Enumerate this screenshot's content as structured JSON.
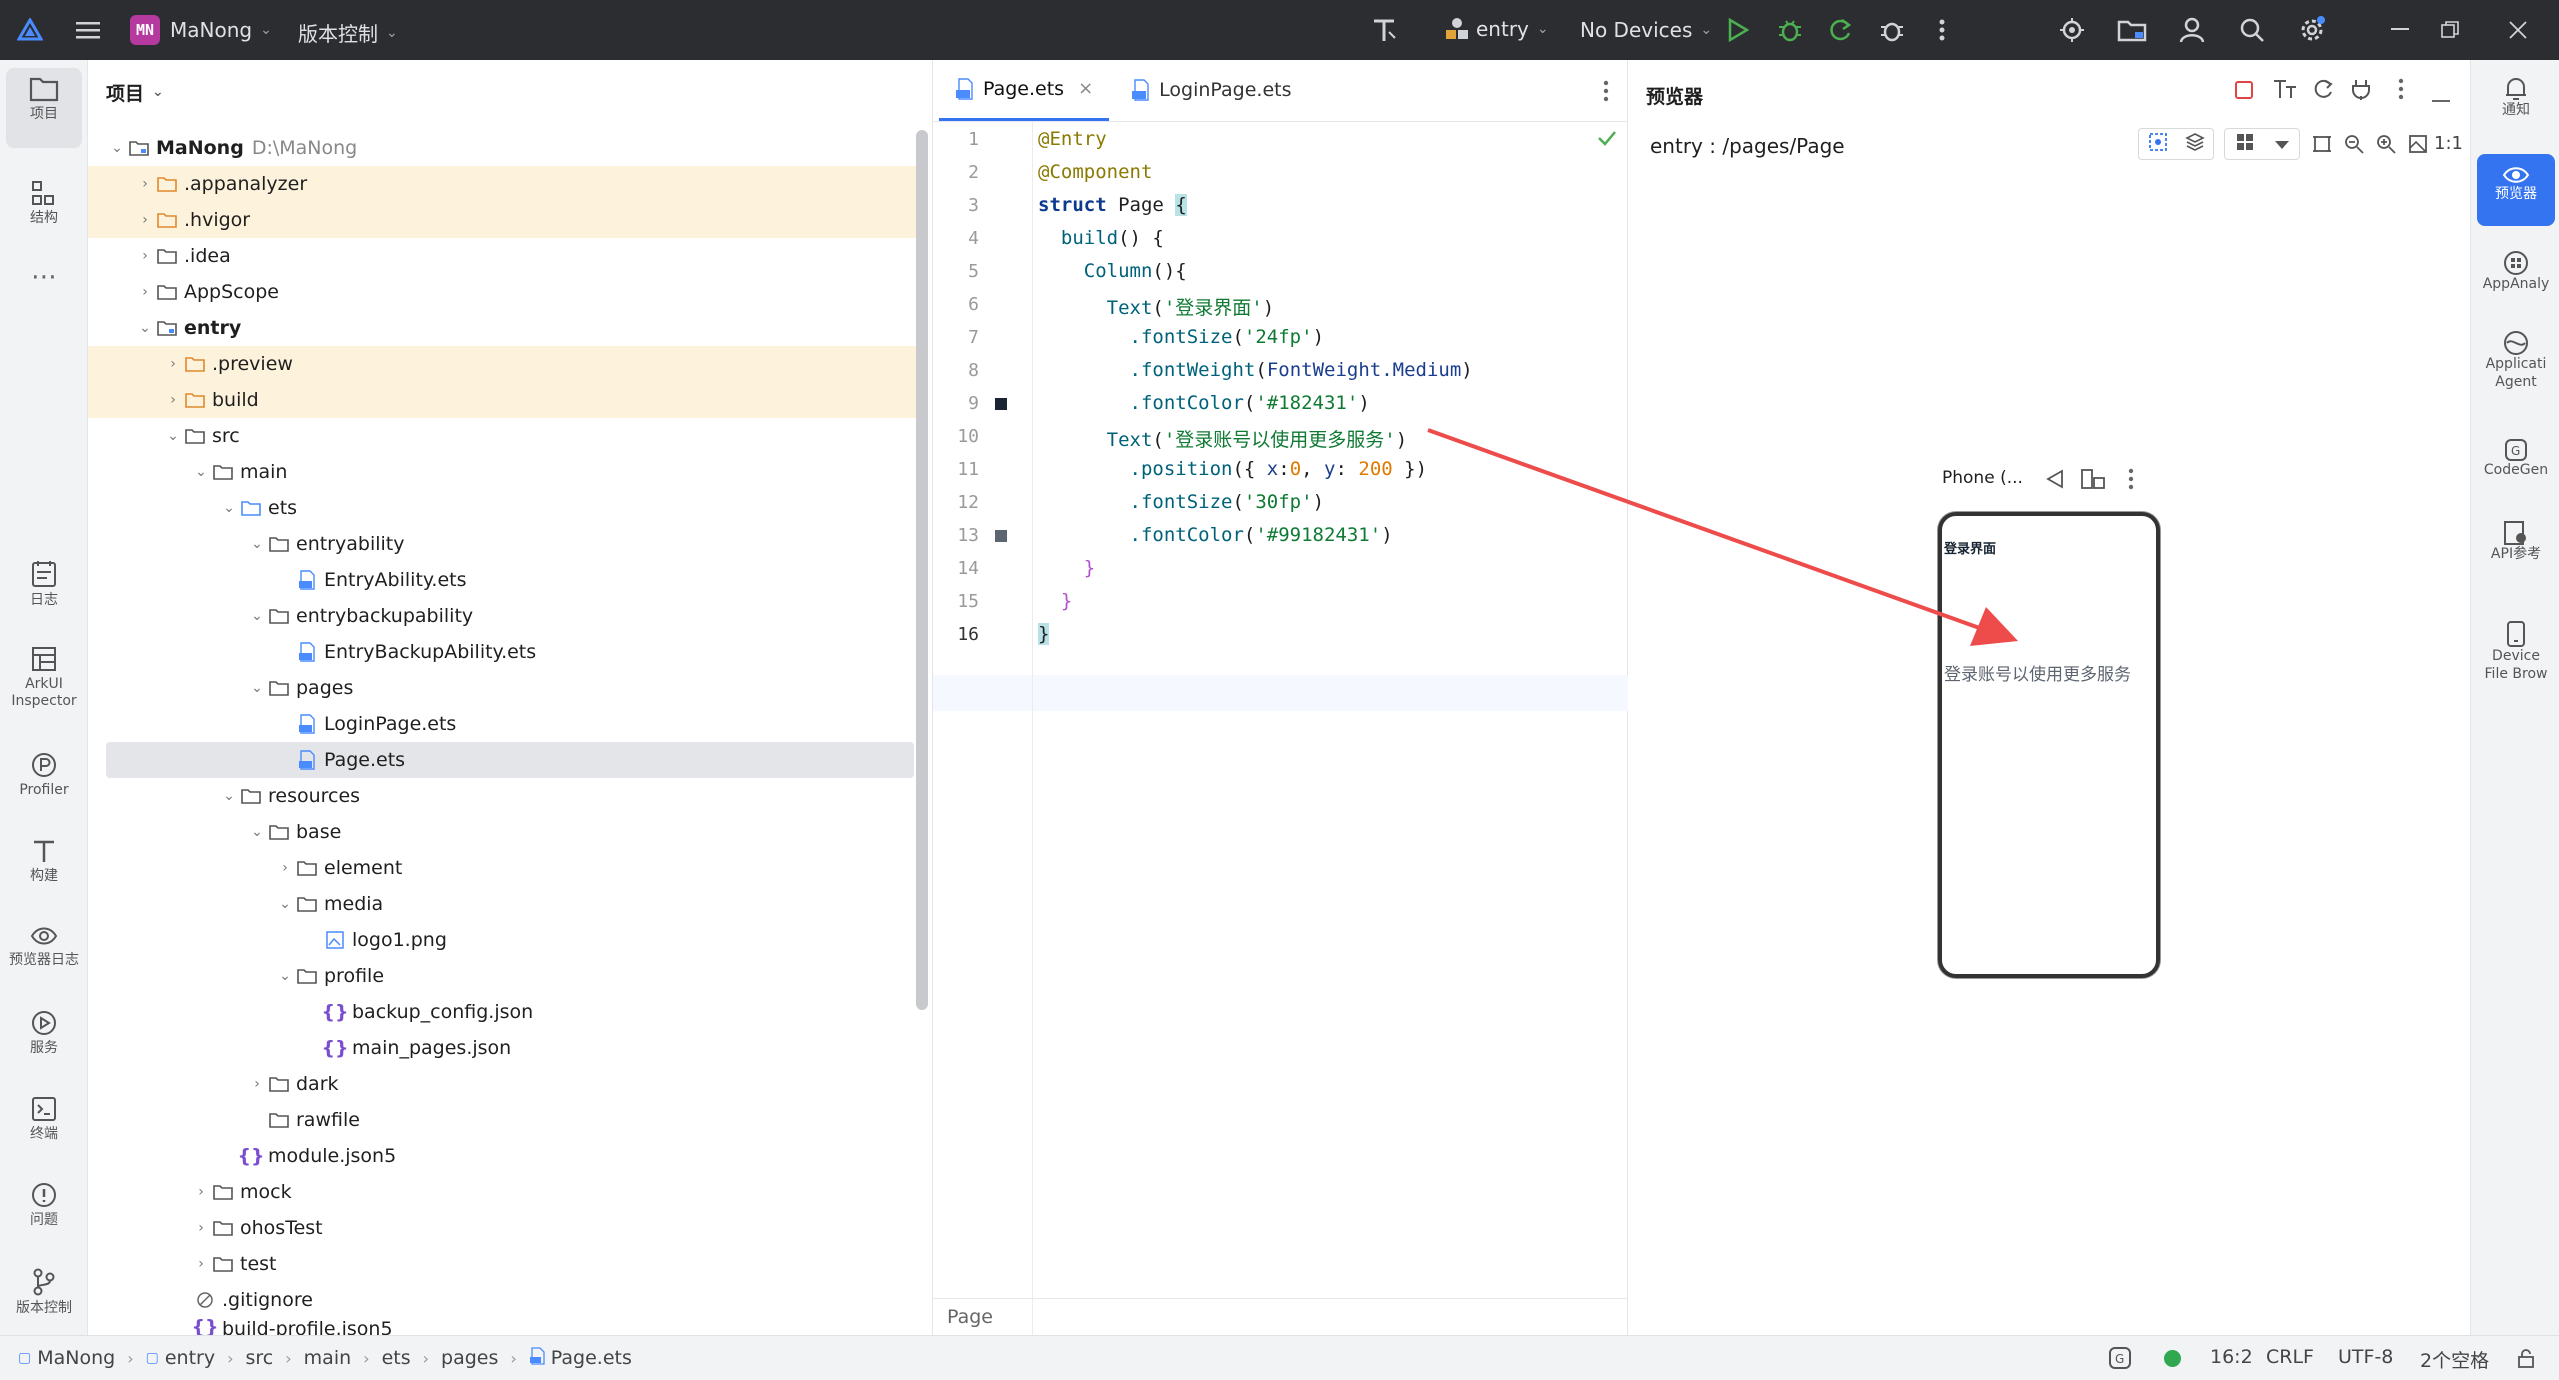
{
  "titlebar": {
    "project_badge": "MN",
    "project_name": "MaNong",
    "vcs": "版本控制",
    "module": "entry",
    "devices": "No Devices"
  },
  "left_tools": [
    {
      "label": "项目"
    },
    {
      "label": "结构"
    },
    {
      "label": "日志"
    },
    {
      "label": "ArkUI Inspector"
    },
    {
      "label": "Profiler"
    },
    {
      "label": "构建"
    },
    {
      "label": "预览器日志"
    },
    {
      "label": "服务"
    },
    {
      "label": "终端"
    },
    {
      "label": "问题"
    },
    {
      "label": "版本控制"
    }
  ],
  "project": {
    "title": "项目",
    "root_name": "MaNong",
    "root_path": "D:\\MaNong",
    "items": [
      {
        "label": ".appanalyzer"
      },
      {
        "label": ".hvigor"
      },
      {
        "label": ".idea"
      },
      {
        "label": "AppScope"
      },
      {
        "label": "entry"
      },
      {
        "label": ".preview"
      },
      {
        "label": "build"
      },
      {
        "label": "src"
      },
      {
        "label": "main"
      },
      {
        "label": "ets"
      },
      {
        "label": "entryability"
      },
      {
        "label": "EntryAbility.ets"
      },
      {
        "label": "entrybackupability"
      },
      {
        "label": "EntryBackupAbility.ets"
      },
      {
        "label": "pages"
      },
      {
        "label": "LoginPage.ets"
      },
      {
        "label": "Page.ets"
      },
      {
        "label": "resources"
      },
      {
        "label": "base"
      },
      {
        "label": "element"
      },
      {
        "label": "media"
      },
      {
        "label": "logo1.png"
      },
      {
        "label": "profile"
      },
      {
        "label": "backup_config.json"
      },
      {
        "label": "main_pages.json"
      },
      {
        "label": "dark"
      },
      {
        "label": "rawfile"
      },
      {
        "label": "module.json5"
      },
      {
        "label": "mock"
      },
      {
        "label": "ohosTest"
      },
      {
        "label": "test"
      },
      {
        "label": ".gitignore"
      },
      {
        "label": "build-profile.json5"
      }
    ]
  },
  "editor": {
    "tabs": [
      {
        "label": "Page.ets"
      },
      {
        "label": "LoginPage.ets"
      }
    ],
    "line_numbers": [
      "1",
      "2",
      "3",
      "4",
      "5",
      "6",
      "7",
      "8",
      "9",
      "10",
      "11",
      "12",
      "13",
      "14",
      "15",
      "16"
    ],
    "code": {
      "l1": "@Entry",
      "l2": "@Component",
      "l3_kw": "struct",
      "l3_name": "Page",
      "l4_fn": "build",
      "l4_rest": "() {",
      "l5_fn": "Column",
      "l5_rest": "(){",
      "l6_fn": "Text",
      "l6_str": "'登录界面'",
      "l7_fn": ".fontSize",
      "l7_str": "'24fp'",
      "l8_fn": ".fontWeight",
      "l8_obj": "FontWeight",
      "l8_member": ".Medium",
      "l9_fn": ".fontColor",
      "l9_str": "'#182431'",
      "l10_fn": "Text",
      "l10_str": "'登录账号以使用更多服务'",
      "l11_fn": ".position",
      "l11_x_key": "x",
      "l11_x_val": "0",
      "l11_y_key": "y",
      "l11_y_val": "200",
      "l12_fn": ".fontSize",
      "l12_str": "'30fp'",
      "l13_fn": ".fontColor",
      "l13_str": "'#99182431'",
      "l14": "}",
      "l15": "}"
    },
    "footer": "Page"
  },
  "preview": {
    "title": "预览器",
    "route": "entry : /pages/Page",
    "device_label": "Phone (...",
    "phone_text_1": "登录界面",
    "phone_text_2": "登录账号以使用更多服务",
    "zoom_label": "1:1"
  },
  "right_tools": [
    {
      "label": "通知"
    },
    {
      "label": "预览器"
    },
    {
      "label": "AppAnaly"
    },
    {
      "label": "Applicati Agent"
    },
    {
      "label": "CodeGen"
    },
    {
      "label": "API参考"
    },
    {
      "label": "Device File Brow"
    }
  ],
  "statusbar": {
    "crumbs": [
      "MaNong",
      "entry",
      "src",
      "main",
      "ets",
      "pages",
      "Page.ets"
    ],
    "cursor": "16:2",
    "line_sep": "CRLF",
    "encoding": "UTF-8",
    "indent": "2个空格"
  },
  "colors": {
    "titlebar": "#2b2d30",
    "accent": "#3574f0",
    "folder_highlight": "#fdf3dc",
    "arrow": "#ee4b4b"
  }
}
